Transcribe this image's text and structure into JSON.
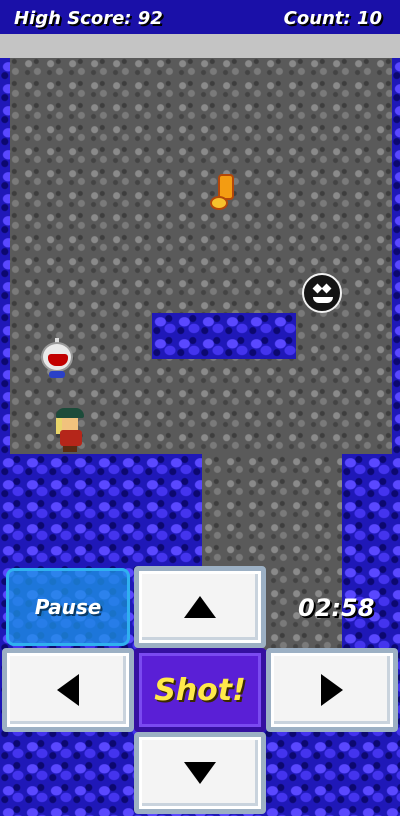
{
  "hud": {
    "high_score_label": "High Score: 92",
    "count_label": "Count: 10"
  },
  "timer": "02:58",
  "controls": {
    "pause_label": "Pause",
    "shot_label": "Shot!",
    "up_icon": "arrow-up-icon",
    "down_icon": "arrow-down-icon",
    "left_icon": "arrow-left-icon",
    "right_icon": "arrow-right-icon"
  },
  "colors": {
    "wall": "#1f18b8",
    "floor": "#5a5a5a",
    "shot_text": "#ffe94a",
    "shot_bg": "#5a1fd6",
    "pause_bg": "#1e96e6"
  },
  "sprites": [
    "player",
    "robot-enemy",
    "bomb-enemy",
    "fire-item"
  ]
}
